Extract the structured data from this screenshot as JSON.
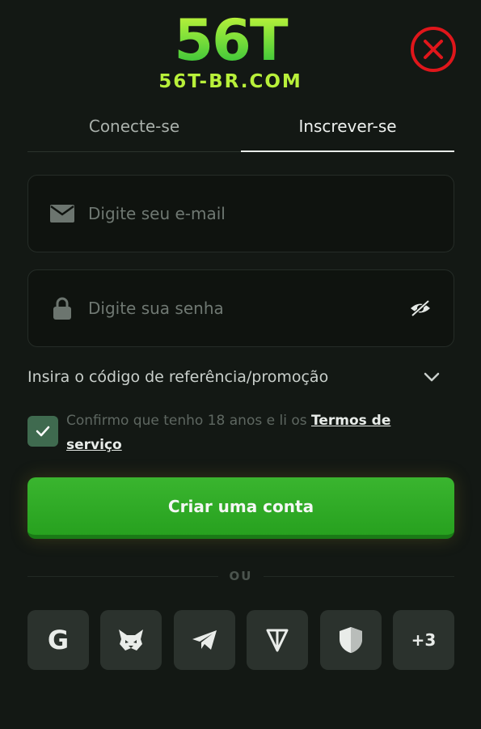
{
  "logo": {
    "main": "56T",
    "sub": "56T-BR.COM"
  },
  "tabs": [
    {
      "label": "Conecte-se",
      "active": false
    },
    {
      "label": "Inscrever-se",
      "active": true
    }
  ],
  "email": {
    "placeholder": "Digite seu e-mail",
    "value": "",
    "icon": "mail-icon"
  },
  "password": {
    "placeholder": "Digite sua senha",
    "value": "",
    "icon": "lock-icon",
    "toggle_icon": "eye-off-icon"
  },
  "referral": {
    "label": "Insira o código de referência/promoção",
    "icon": "chevron-down-icon"
  },
  "confirm": {
    "checked": true,
    "text": "Confirmo que tenho 18 anos e li os ",
    "link": "Termos de serviço"
  },
  "create_button": {
    "label": "Criar uma conta"
  },
  "divider": {
    "label": "OU"
  },
  "socials": [
    {
      "name": "google",
      "label": "G"
    },
    {
      "name": "metamask",
      "label": ""
    },
    {
      "name": "telegram",
      "label": ""
    },
    {
      "name": "ton",
      "label": ""
    },
    {
      "name": "shield",
      "label": ""
    },
    {
      "name": "more",
      "label": "+3"
    }
  ],
  "colors": {
    "background": "#131814",
    "accent_green": "#2fa82a",
    "close_red": "#e0161b",
    "checkbox": "#3f6a4f"
  }
}
